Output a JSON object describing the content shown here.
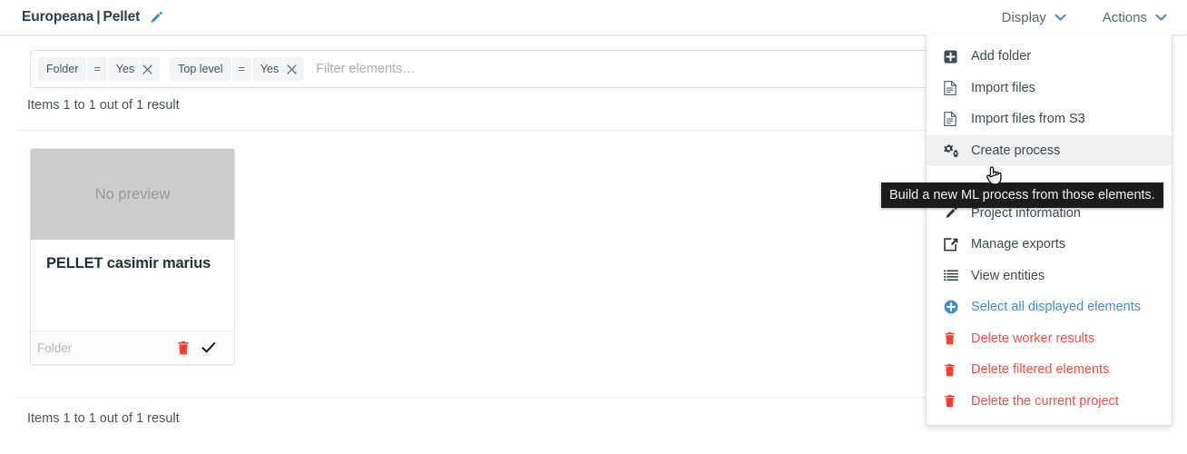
{
  "header": {
    "brand_left": "Europeana",
    "brand_separator": "|",
    "brand_right": "Pellet",
    "edit_icon": "pencil-icon",
    "display_label": "Display",
    "actions_label": "Actions",
    "caret_icon": "chevron-down-icon",
    "accent_blue": "#3d8ed8"
  },
  "filters": {
    "placeholder": "Filter elements…",
    "chips": [
      {
        "field": "Folder",
        "operator": "=",
        "value": "Yes",
        "remove_icon": "close-icon"
      },
      {
        "field": "Top level",
        "operator": "=",
        "value": "Yes",
        "remove_icon": "close-icon"
      }
    ]
  },
  "results": {
    "top_text": "Items 1 to 1 out of 1 result",
    "bottom_text": "Items 1 to 1 out of 1 result"
  },
  "card": {
    "preview_text": "No preview",
    "title": "PELLET casimir marius",
    "type_label": "Folder",
    "delete_icon": "trash-icon",
    "confirm_icon": "check-icon",
    "preview_bg": "#cccccc"
  },
  "actions_menu": {
    "items": [
      {
        "label": "Add folder",
        "icon": "plus-square-icon",
        "style": "default",
        "highlighted": false
      },
      {
        "label": "Import files",
        "icon": "file-icon",
        "style": "default",
        "highlighted": false
      },
      {
        "label": "Import files from S3",
        "icon": "file-icon",
        "style": "default",
        "highlighted": false
      },
      {
        "label": "Create process",
        "icon": "gears-icon",
        "style": "default",
        "highlighted": true
      },
      {
        "label": "",
        "icon": "",
        "style": "default",
        "highlighted": false
      },
      {
        "label": "Project information",
        "icon": "pencil-icon",
        "style": "default",
        "highlighted": false
      },
      {
        "label": "Manage exports",
        "icon": "export-icon",
        "style": "default",
        "highlighted": false
      },
      {
        "label": "View entities",
        "icon": "list-icon",
        "style": "default",
        "highlighted": false
      },
      {
        "label": "Select all displayed elements",
        "icon": "plus-circle-icon",
        "style": "blue",
        "highlighted": false
      },
      {
        "label": "Delete worker results",
        "icon": "trash-icon",
        "style": "red",
        "highlighted": false
      },
      {
        "label": "Delete filtered elements",
        "icon": "trash-icon",
        "style": "red",
        "highlighted": false
      },
      {
        "label": "Delete the current project",
        "icon": "trash-icon",
        "style": "red",
        "highlighted": false
      }
    ],
    "blue_color": "#3d8ed8",
    "red_color": "#fa4b42"
  },
  "tooltip": {
    "text": "Build a new ML process from those elements.",
    "background": "#1c1c1c"
  },
  "cursor": {
    "icon": "pointer-hand-cursor"
  }
}
